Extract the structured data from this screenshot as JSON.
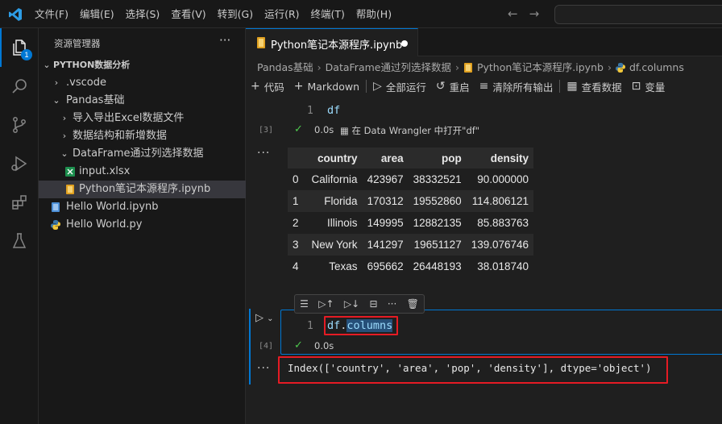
{
  "menu": [
    "文件(F)",
    "编辑(E)",
    "选择(S)",
    "查看(V)",
    "转到(G)",
    "运行(R)",
    "终端(T)",
    "帮助(H)"
  ],
  "activity": {
    "explorer_badge": "1"
  },
  "sidebar": {
    "title": "资源管理器",
    "more": "···",
    "root": "PYTHON数据分析",
    "items": [
      {
        "label": ".vscode",
        "type": "folder-closed"
      },
      {
        "label": "Pandas基础",
        "type": "folder-open"
      },
      {
        "label": "导入导出Excel数据文件",
        "type": "folder-closed"
      },
      {
        "label": "数据结构和新增数据",
        "type": "folder-closed"
      },
      {
        "label": "DataFrame通过列选择数据",
        "type": "folder-open"
      },
      {
        "label": "input.xlsx",
        "type": "excel-file"
      },
      {
        "label": "Python笔记本源程序.ipynb",
        "type": "notebook-file"
      },
      {
        "label": "Hello World.ipynb",
        "type": "notebook-file"
      },
      {
        "label": "Hello World.py",
        "type": "python-file"
      }
    ]
  },
  "editor": {
    "tab_label": "Python笔记本源程序.ipynb",
    "breadcrumb": [
      "Pandas基础",
      "DataFrame通过列选择数据",
      "Python笔记本源程序.ipynb",
      "df.columns"
    ],
    "toolbar": {
      "code": "代码",
      "markdown": "Markdown",
      "run_all": "全部运行",
      "restart": "重启",
      "clear_outputs": "清除所有输出",
      "view_data": "查看数据",
      "variables": "变量"
    }
  },
  "cell1": {
    "line_number": "1",
    "code": "df",
    "exec_count": "[3]",
    "time": "0.0s",
    "wrangler": "在 Data Wrangler 中打开\"df\"",
    "more": "···"
  },
  "dataframe": {
    "columns": [
      "",
      "country",
      "area",
      "pop",
      "density"
    ],
    "rows": [
      [
        "0",
        "California",
        "423967",
        "38332521",
        "90.000000"
      ],
      [
        "1",
        "Florida",
        "170312",
        "19552860",
        "114.806121"
      ],
      [
        "2",
        "Illinois",
        "149995",
        "12882135",
        "85.883763"
      ],
      [
        "3",
        "New York",
        "141297",
        "19651127",
        "139.076746"
      ],
      [
        "4",
        "Texas",
        "695662",
        "26448193",
        "38.018740"
      ]
    ]
  },
  "cell2": {
    "line_number": "1",
    "code_obj": "df",
    "code_dot": ".",
    "code_attr": "columns",
    "exec_count": "[4]",
    "time": "0.0s",
    "output": "Index(['country', 'area', 'pop', 'density'], dtype='object')",
    "more": "···"
  },
  "colors": {
    "accent": "#0078d4",
    "highlight_box": "#e51b24",
    "success": "#4ec94e"
  }
}
